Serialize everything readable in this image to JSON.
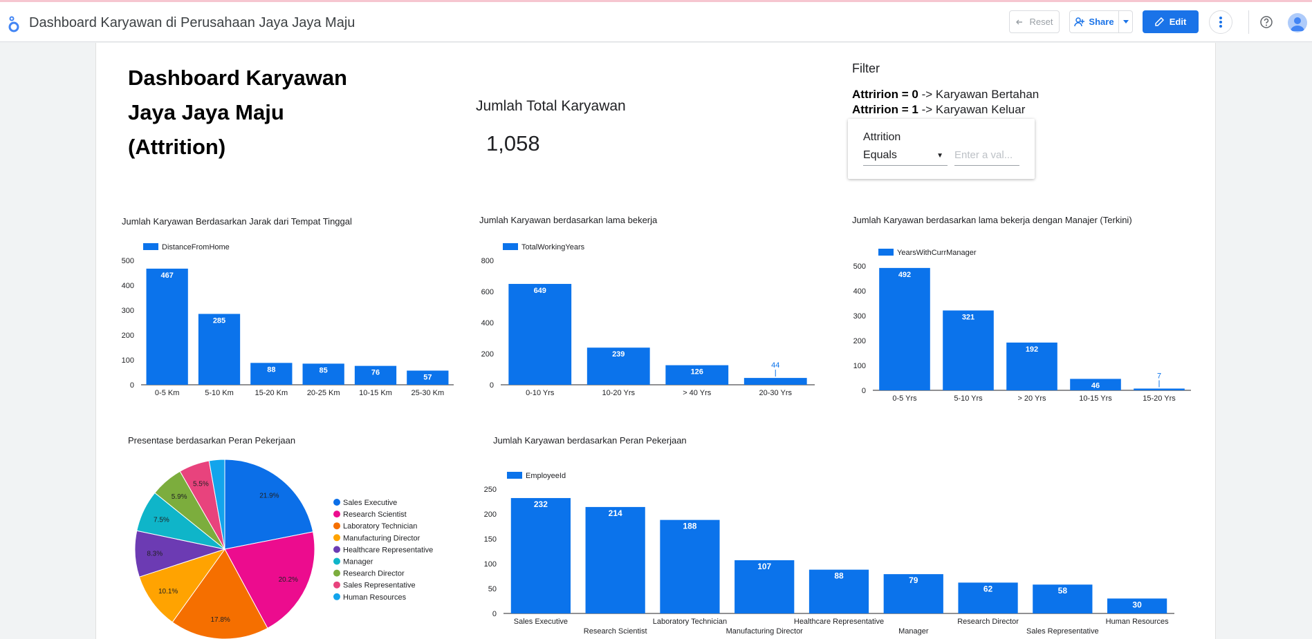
{
  "app": {
    "title": "Dashboard Karyawan di Perusahaan Jaya Jaya Maju",
    "reset_label": "Reset",
    "share_label": "Share",
    "edit_label": "Edit"
  },
  "dashboard": {
    "title_lines": [
      "Dashboard Karyawan",
      "Jaya Jaya Maju",
      "(Attrition)"
    ],
    "kpi_label": "Jumlah Total Karyawan",
    "kpi_value": "1,058",
    "filter_label": "Filter",
    "filter_note_1_key": "Attririon = 0",
    "filter_note_1_text": " -> Karyawan Bertahan",
    "filter_note_2_key": "Attririon = 1",
    "filter_note_2_text": " -> Karyawan Keluar",
    "filter_control": {
      "title": "Attrition",
      "operator": "Equals",
      "placeholder": "Enter a val..."
    }
  },
  "colors": {
    "accent": "#1a73e8",
    "bar": "#0b73eb"
  },
  "chart_data": [
    {
      "id": "distance",
      "type": "bar",
      "title": "Jumlah Karyawan Berdasarkan Jarak dari Tempat Tinggal",
      "series_name": "DistanceFromHome",
      "categories": [
        "0-5 Km",
        "5-10 Km",
        "15-20 Km",
        "20-25 Km",
        "10-15 Km",
        "25-30 Km"
      ],
      "values": [
        467,
        285,
        88,
        85,
        76,
        57
      ],
      "yticks": [
        0,
        100,
        200,
        300,
        400,
        500
      ],
      "ylim": [
        0,
        500
      ],
      "legend": "top-left"
    },
    {
      "id": "working_years",
      "type": "bar",
      "title": "Jumlah Karyawan berdasarkan lama bekerja",
      "series_name": "TotalWorkingYears",
      "categories": [
        "0-10 Yrs",
        "10-20 Yrs",
        "> 40 Yrs",
        "20-30 Yrs"
      ],
      "values": [
        649,
        239,
        126,
        44
      ],
      "yticks": [
        0,
        200,
        400,
        600,
        800
      ],
      "ylim": [
        0,
        800
      ],
      "legend": "top-left"
    },
    {
      "id": "curr_manager",
      "type": "bar",
      "title": "Jumlah Karyawan berdasarkan lama bekerja dengan Manajer (Terkini)",
      "series_name": "YearsWithCurrManager",
      "categories": [
        "0-5 Yrs",
        "5-10 Yrs",
        "> 20 Yrs",
        "10-15 Yrs",
        "15-20 Yrs"
      ],
      "values": [
        492,
        321,
        192,
        46,
        7
      ],
      "yticks": [
        0,
        100,
        200,
        300,
        400,
        500
      ],
      "ylim": [
        0,
        500
      ],
      "legend": "top-left"
    },
    {
      "id": "role_pie",
      "type": "pie",
      "title": "Presentase berdasarkan Peran Pekerjaan",
      "labels": [
        "Sales Executive",
        "Research Scientist",
        "Laboratory Technician",
        "Manufacturing Director",
        "Healthcare Representative",
        "Manager",
        "Research Director",
        "Sales Representative",
        "Human Resources"
      ],
      "values": [
        21.9,
        20.2,
        17.8,
        10.1,
        8.3,
        7.5,
        5.9,
        5.5,
        2.8
      ],
      "value_labels": [
        "21.9%",
        "20.2%",
        "17.8%",
        "10.1%",
        "8.3%",
        "7.5%",
        "5.9%",
        "5.5%",
        ""
      ],
      "colors": [
        "#0b6fe8",
        "#ec0c8e",
        "#f56f00",
        "#ffa301",
        "#6c3bb3",
        "#0fb5c9",
        "#7cad3d",
        "#e8437d",
        "#13a4ec"
      ],
      "legend": "right"
    },
    {
      "id": "role_bar",
      "type": "bar",
      "title": "Jumlah Karyawan berdasarkan Peran Pekerjaan",
      "series_name": "EmployeeId",
      "categories": [
        "Sales Executive",
        "Research Scientist",
        "Laboratory Technician",
        "Manufacturing Director",
        "Healthcare Representative",
        "Manager",
        "Research Director",
        "Sales Representative",
        "Human Resources"
      ],
      "values": [
        232,
        214,
        188,
        107,
        88,
        79,
        62,
        58,
        30
      ],
      "yticks": [
        0,
        50,
        100,
        150,
        200,
        250
      ],
      "ylim": [
        0,
        250
      ],
      "legend": "top-left"
    }
  ]
}
